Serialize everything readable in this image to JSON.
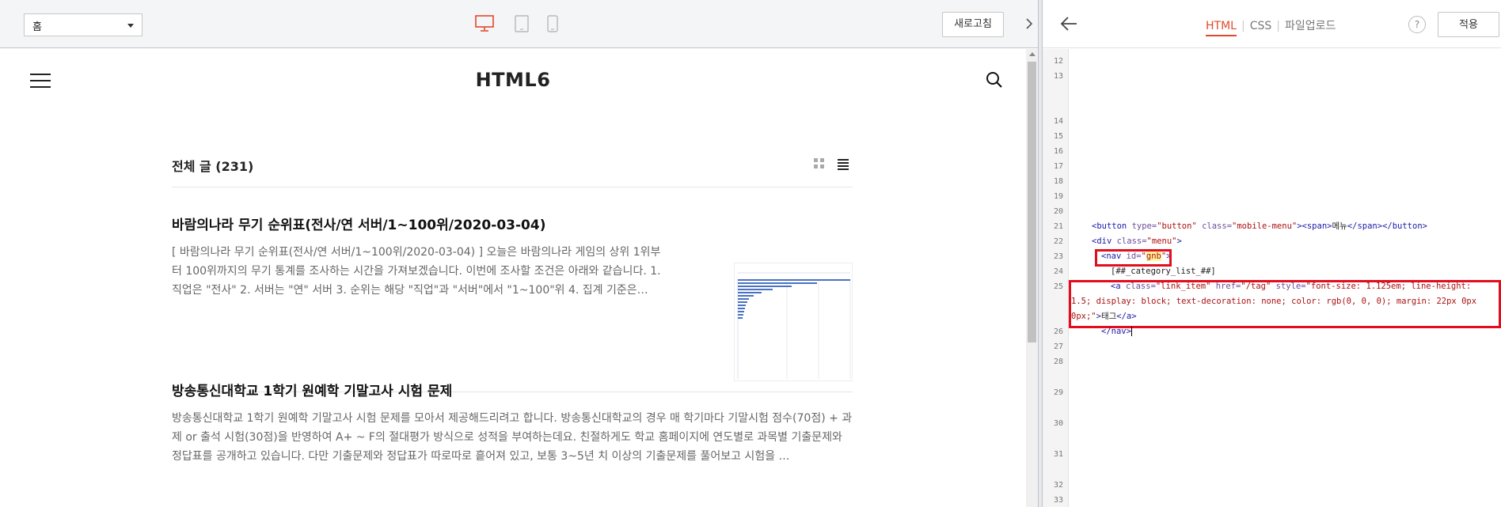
{
  "toolbar": {
    "page_select": "홈",
    "refresh_label": "새로고침"
  },
  "blog": {
    "title": "HTML6",
    "list_title": "전체 글 (231)",
    "posts": [
      {
        "title": "바람의나라 무기 순위표(전사/연 서버/1~100위/2020-03-04)",
        "excerpt": "[ 바람의나라 무기 순위표(전사/연 서버/1~100위/2020-03-04) ] 오늘은 바람의나라 게임의 상위 1위부터 100위까지의 무기 통계를 조사하는 시간을 가져보겠습니다. 이번에 조사할 조건은 아래와 같습니다. 1. 직업은 \"전사\" 2. 서버는 \"연\" 서버 3. 순위는 해당 \"직업\"과 \"서버\"에서 \"1~100\"위 4. 집계 기준은…"
      },
      {
        "title": "방송통신대학교 1학기 원예학 기말고사 시험 문제",
        "excerpt": "방송통신대학교 1학기 원예학 기말고사 시험 문제를 모아서 제공해드리려고 합니다. 방송통신대학교의 경우 매 학기마다 기말시험 점수(70점) + 과제 or 출석 시험(30점)을 반영하여 A+ ~ F의 절대평가 방식으로 성적을 부여하는데요. 친절하게도 학교 홈페이지에 연도별로 과목별 기출문제와 정답표를 공개하고 있습니다. 다만 기출문제와 정답표가 따로따로 흩어져 있고, 보통 3~5년 치 이상의 기출문제를 풀어보고 시험을 …"
      }
    ]
  },
  "editor": {
    "tabs": [
      "HTML",
      "CSS",
      "파일업로드"
    ],
    "active_tab": "HTML",
    "help_label": "?",
    "apply_label": "적용",
    "line_numbers": [
      "12",
      "13",
      "14",
      "15",
      "16",
      "17",
      "18",
      "19",
      "20",
      "21",
      "22",
      "23",
      "24",
      "25",
      "26",
      "27",
      "28",
      "29",
      "30",
      "31",
      "32",
      "33"
    ],
    "code": {
      "l21_a": "<button ",
      "l21_b": "type=",
      "l21_c": "\"button\"",
      "l21_d": " class=",
      "l21_e": "\"mobile-menu\"",
      "l21_f": "><span>",
      "l21_g": "메뉴",
      "l21_h": "</span></button>",
      "l22_a": "<div ",
      "l22_b": "class=",
      "l22_c": "\"menu\"",
      "l22_d": ">",
      "l23_a": "<nav ",
      "l23_b": "id=",
      "l23_c": "\"",
      "l23_d": "gnb",
      "l23_e": "\"",
      "l23_f": ">",
      "l24": "[##_category_list_##]",
      "l25_a": "<a ",
      "l25_b": "class=",
      "l25_c": "\"link_item\"",
      "l25_d": " href=",
      "l25_e": "\"/tag\"",
      "l25_f": " style=",
      "l25_g": "\"font-size: 1.125em; line-height:",
      "l25_2": "1.5; display: block; text-decoration: none; color: rgb(0, 0, 0); margin: 22px 0px",
      "l25_3a": "0px;\"",
      "l25_3b": ">",
      "l25_3c": "태그",
      "l25_3d": "</a>",
      "l26": "</nav>"
    }
  },
  "colors": {
    "accent": "#e1492c",
    "highlight_box": "#e20d1d",
    "tag": "#1a1aa6",
    "attr": "#6b4c9a",
    "value": "#aa1111"
  },
  "icons": [
    "desktop-icon",
    "tablet-icon",
    "mobile-icon",
    "collapse-arrow-icon",
    "hamburger-icon",
    "search-icon",
    "grid-view-icon",
    "list-view-icon",
    "back-arrow-icon",
    "help-icon"
  ]
}
